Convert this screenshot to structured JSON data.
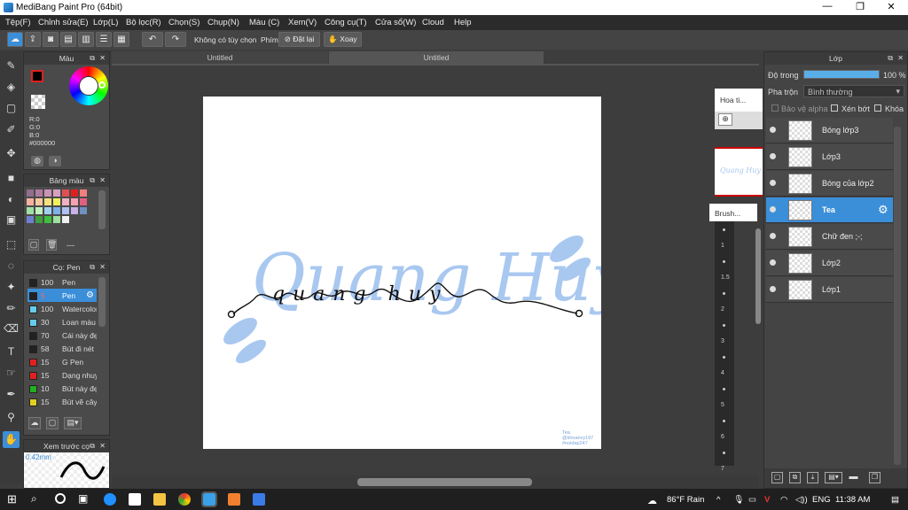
{
  "app": {
    "title": "MediBang Paint Pro (64bit)",
    "win_min": "—",
    "win_max": "❐",
    "win_close": "✕"
  },
  "menu": [
    "Tệp(F)",
    "Chỉnh sửa(E)",
    "Lớp(L)",
    "Bộ lọc(R)",
    "Chọn(S)",
    "Chụp(N)",
    "Màu (C)",
    "Xem(V)",
    "Công cụ(T)",
    "Cửa sổ(W)",
    "Cloud",
    "Help"
  ],
  "toolbar": {
    "no_option": "Không có tùy chọn",
    "keys_label": "Phím",
    "reset": "Đặt lại",
    "rotate": "Xoay"
  },
  "tabs": [
    "Untitled",
    "Untitled"
  ],
  "color_panel": {
    "title": "Màu",
    "r": "R:0",
    "g": "G:0",
    "b": "B:0",
    "hex": "#000000",
    "foreground": "#000000"
  },
  "palette_panel": {
    "title": "Bảng màu",
    "colors": [
      "#8e6f8e",
      "#b07aa1",
      "#c994b3",
      "#d8a0c0",
      "#e05050",
      "#e02020",
      "#f08080",
      "#f5b0a0",
      "#f7c8a0",
      "#f5e080",
      "#f0f060",
      "#f0b0c0",
      "#f7a0b0",
      "#e06080",
      "#a0e0a0",
      "#c0f0c0",
      "#a0d0f0",
      "#80b0e8",
      "#b0c0f0",
      "#c8b0e8",
      "#7090c0",
      "#7080d0",
      "#40a040",
      "#40c040",
      "#a0e0a0",
      "#f0f0f0"
    ],
    "count": "---"
  },
  "brush_panel": {
    "title": "Cọ: Pen",
    "items": [
      {
        "size": "100",
        "name": "Pen",
        "color": "#222222"
      },
      {
        "size": "5",
        "name": "Pen",
        "color": "#222222"
      },
      {
        "size": "100",
        "name": "Watercolor",
        "color": "#66ccee"
      },
      {
        "size": "30",
        "name": "Loan màu",
        "color": "#66ccee"
      },
      {
        "size": "70",
        "name": "Cái này đẹp",
        "color": "#222222"
      },
      {
        "size": "58",
        "name": "Bút đi nét",
        "color": "#222222"
      },
      {
        "size": "15",
        "name": "G Pen",
        "color": "#e02020"
      },
      {
        "size": "15",
        "name": "Dạng nhuyễn",
        "color": "#e02020"
      },
      {
        "size": "10",
        "name": "Bút này đẹp",
        "color": "#20b020"
      },
      {
        "size": "15",
        "name": "Bút vẽ cây",
        "color": "#e0d020"
      }
    ]
  },
  "preview_panel": {
    "title": "Xem trước cọ",
    "size": "0.42mm"
  },
  "layers_panel": {
    "title": "Lớp",
    "opacity_label": "Độ trong",
    "opacity": "100 %",
    "opacity_fraction": 1.0,
    "blend_label": "Pha trộn",
    "blend_value": "Bình thường",
    "protect_alpha": "Bảo vệ alpha",
    "clip": "Xén bớt",
    "lock": "Khóa",
    "layers": [
      "Bóng lớp3",
      "Lớp3",
      "Bóng của lớp2",
      "Tea",
      "Chữ đen ;-;",
      "Lớp2",
      "Lớp1"
    ],
    "selected": "Tea"
  },
  "materials": {
    "tab1": "Hoa ti...",
    "tab2": "Brush...",
    "thumb_text": "Quang Huy",
    "sizes": [
      "1",
      "1.5",
      "2",
      "3",
      "4",
      "5",
      "6",
      "7"
    ]
  },
  "canvas": {
    "bg_text": "Quang Huy",
    "script_text": "quang huy",
    "watermark": "Tea\n@khoanvy197\n#noidap247",
    "text_color": "#a9c8f0",
    "ink_color": "#111111"
  },
  "taskbar": {
    "weather": "86°F  Rain",
    "lang": "ENG",
    "time": "11:38 AM"
  }
}
